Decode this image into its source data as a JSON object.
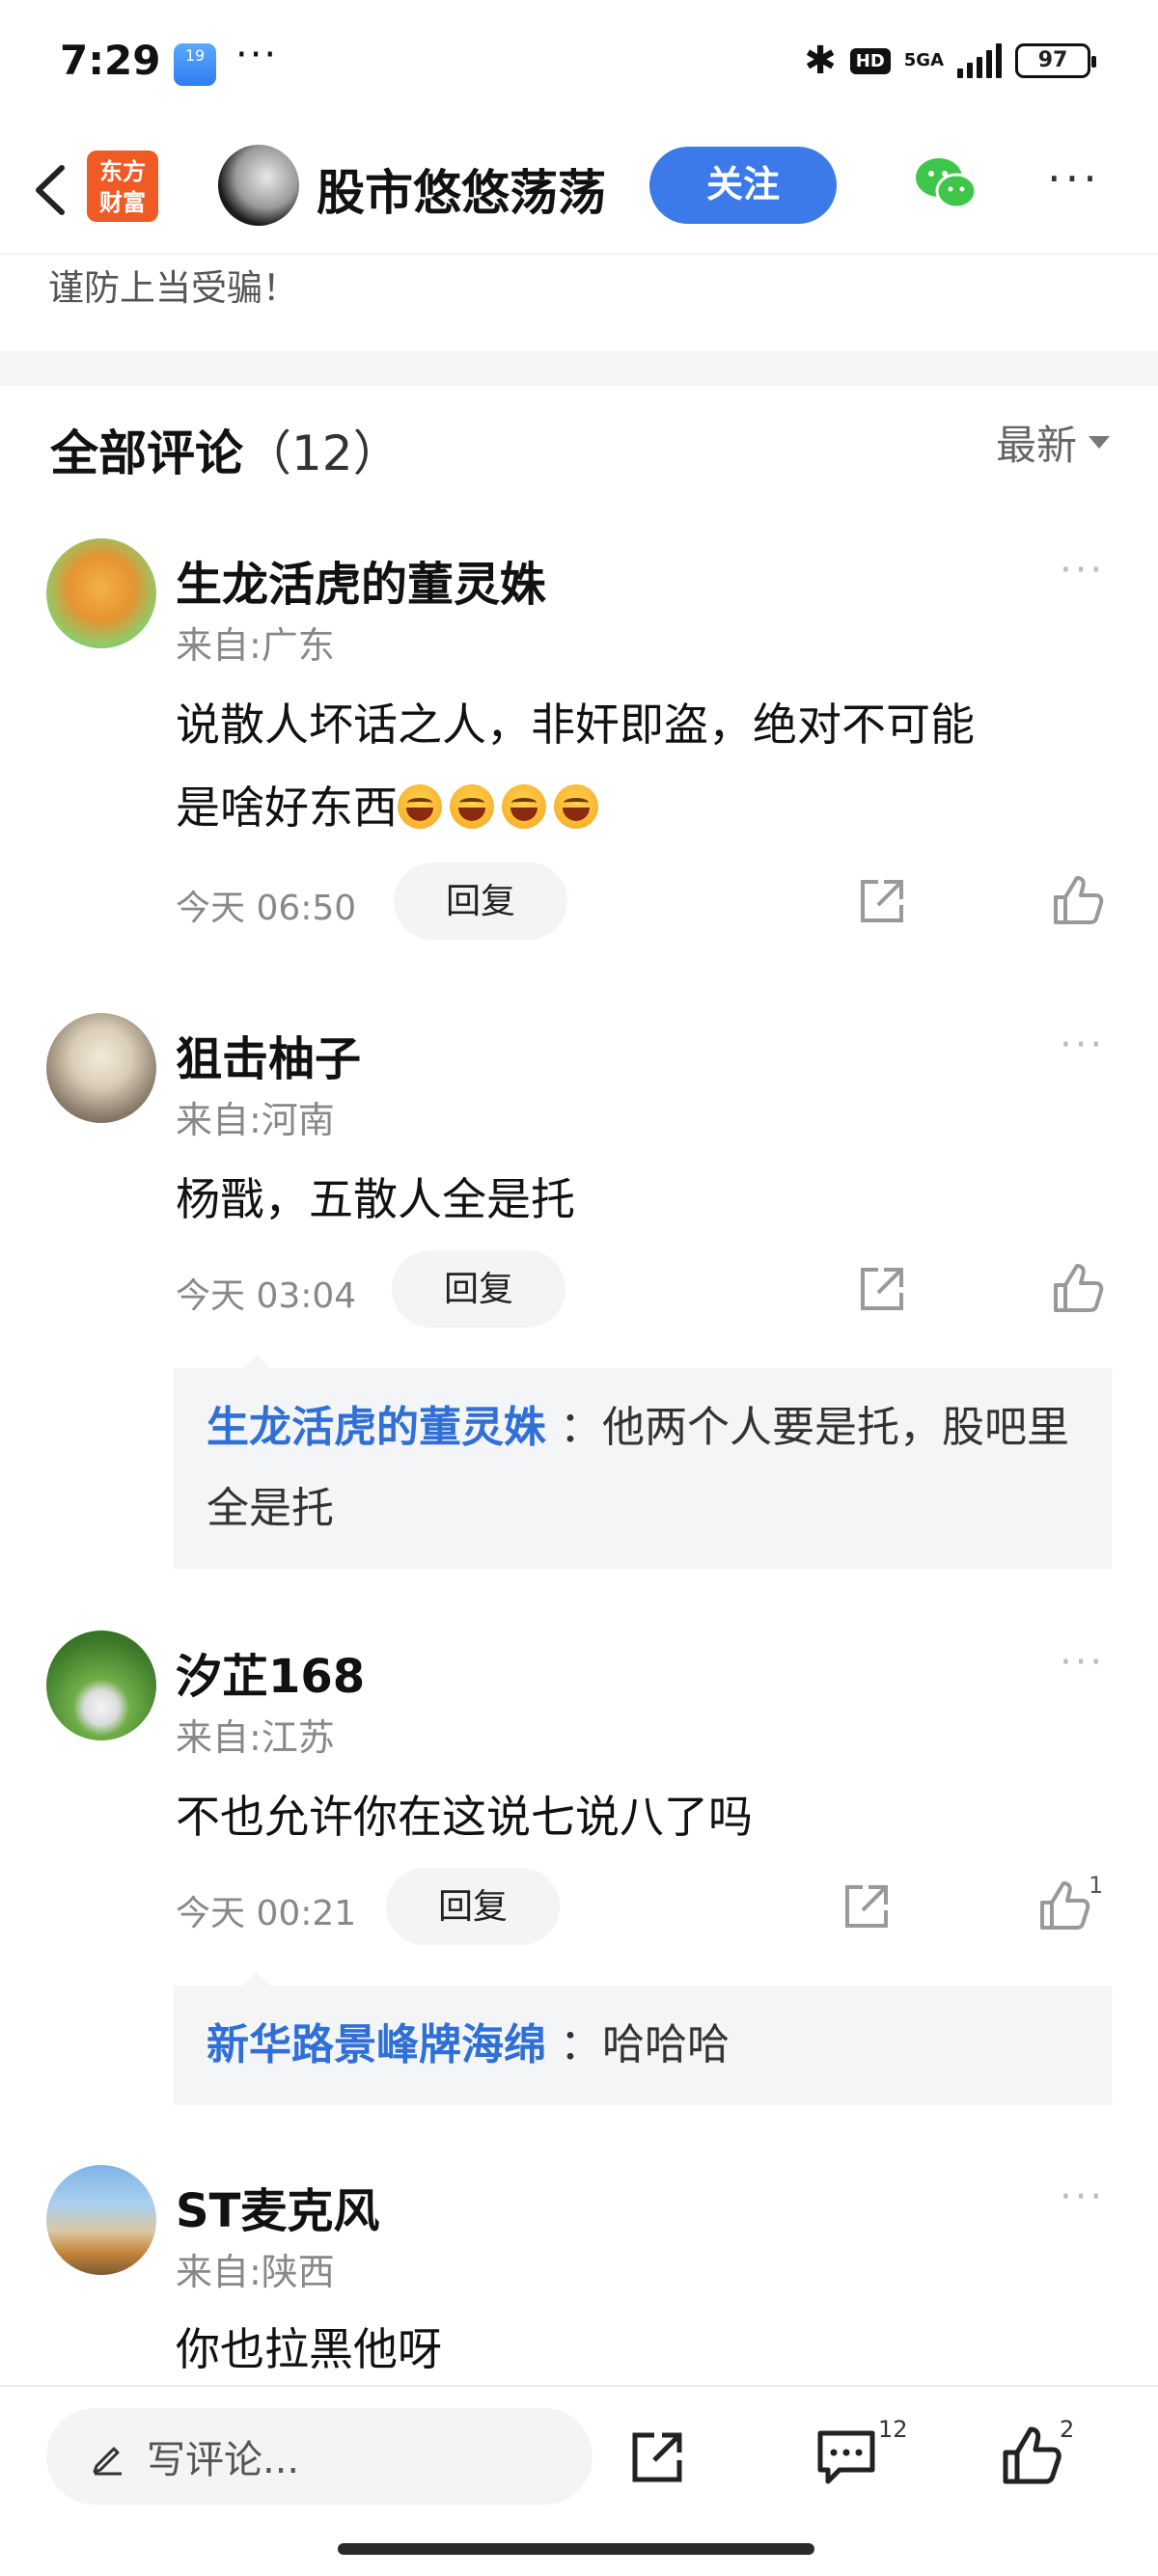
{
  "status_bar": {
    "time": "7:29",
    "weather_badge": "19",
    "dots": "···",
    "network": "5GA",
    "hd": "HD",
    "battery": "97"
  },
  "nav": {
    "logo_text_1": "东方",
    "logo_text_2": "财富",
    "title": "股市悠悠荡荡",
    "follow_label": "关注"
  },
  "article_tail": "谨防上当受骗！",
  "comments_header": {
    "title": "全部评论",
    "count": "（12）",
    "sort_label": "最新"
  },
  "comments": [
    {
      "author": "生龙活虎的董灵姝",
      "location": "来自:广东",
      "body_line1": "说散人坏话之人，非奸即盗，绝对不可能",
      "body_line2": "是啥好东西",
      "time": "今天 06:50",
      "reply_label": "回复"
    },
    {
      "author": "狙击柚子",
      "location": "来自:河南",
      "body": "杨戬，五散人全是托",
      "time": "今天 03:04",
      "reply_label": "回复",
      "sub_reply": {
        "author": "生龙活虎的董灵姝",
        "text": "：他两个人要是托，股吧里全是托"
      }
    },
    {
      "author": "汐芷168",
      "location": "来自:江苏",
      "body": "不也允许你在这说七说八了吗",
      "time": "今天 00:21",
      "reply_label": "回复",
      "like_count": "1",
      "sub_reply": {
        "author": "新华路景峰牌海绵",
        "text": "：哈哈哈"
      }
    },
    {
      "author": "ST麦克风",
      "location": "来自:陕西",
      "body": "你也拉黑他呀"
    }
  ],
  "bottom_bar": {
    "input_placeholder": "写评论...",
    "comment_count": "12",
    "like_count": "2"
  },
  "colors": {
    "accent_blue": "#3b7ae8",
    "link_blue": "#2f6fd6",
    "logo_orange": "#f05a24"
  }
}
